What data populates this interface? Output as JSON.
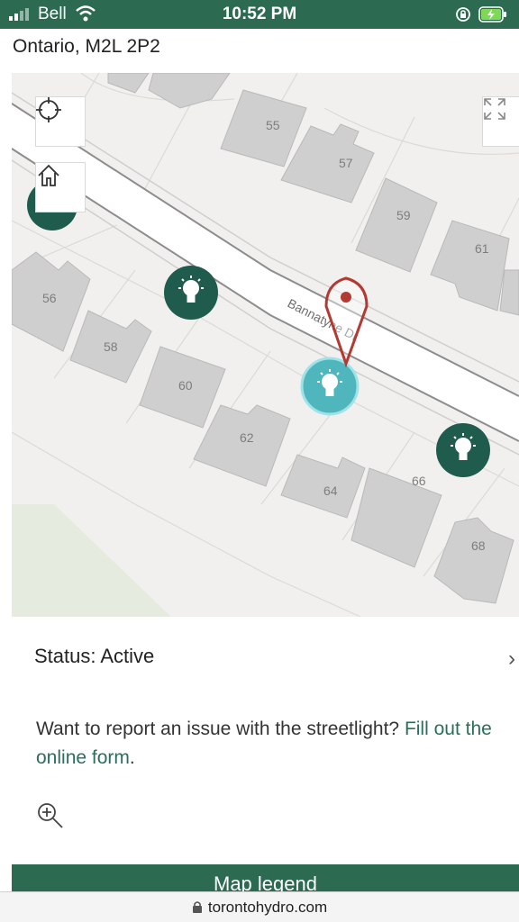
{
  "status_bar": {
    "carrier": "Bell",
    "time": "10:52 PM"
  },
  "header": {
    "address": "Ontario, M2L 2P2"
  },
  "map": {
    "street_label": "Bannatyne Dr",
    "house_numbers": [
      "55",
      "57",
      "59",
      "61",
      "56",
      "58",
      "60",
      "62",
      "64",
      "66",
      "68"
    ],
    "colors": {
      "streetlight": "#1f5c4d",
      "selected_streetlight": "#4fb6bd",
      "pin": "#b23a32"
    }
  },
  "info": {
    "status_text": "Status: Active",
    "report_text": "Want to report an issue with the streetlight? ",
    "report_link": "Fill out the online form",
    "report_period": "."
  },
  "legend_button": "Map legend",
  "url": "torontohydro.com"
}
